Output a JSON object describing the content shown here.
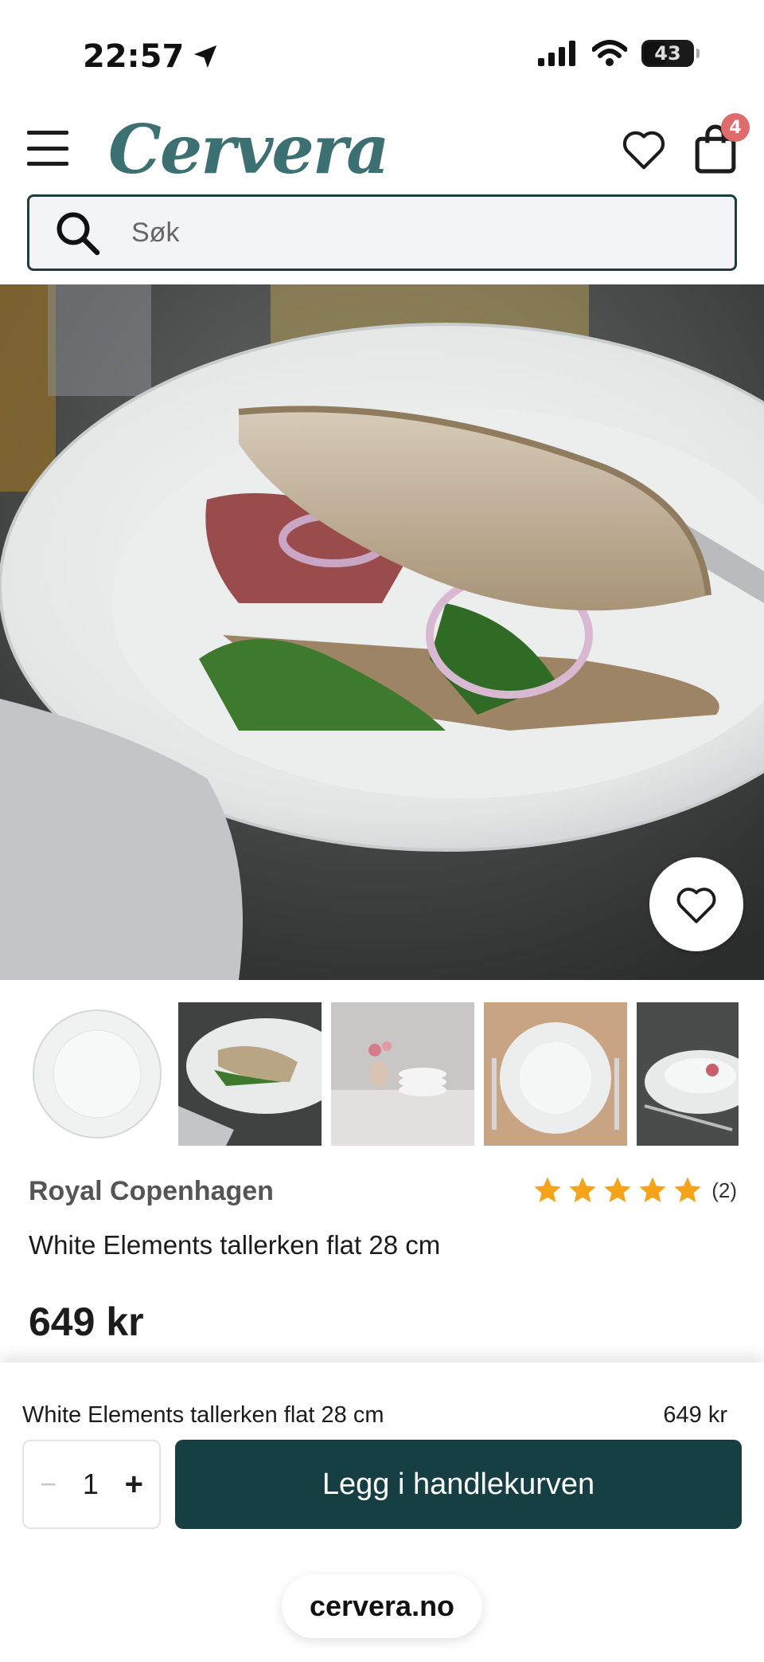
{
  "status_bar": {
    "time": "22:57",
    "battery": "43"
  },
  "header": {
    "logo": "Cervera",
    "cart_count": "4"
  },
  "search": {
    "placeholder": "Søk"
  },
  "product": {
    "brand": "Royal Copenhagen",
    "name": "White Elements tallerken flat 28 cm",
    "price": "649 kr",
    "rating_stars": 5,
    "rating_count": "(2)"
  },
  "sticky_bar": {
    "name": "White Elements tallerken flat 28 cm",
    "price": "649 kr",
    "quantity": "1",
    "minus": "−",
    "plus": "+",
    "add_to_cart": "Legg i handlekurven"
  },
  "browser": {
    "url": "cervera.no"
  },
  "colors": {
    "brand_teal": "#3c7174",
    "button_dark": "#153f42",
    "badge": "#e06b6b",
    "star": "#f5a418"
  },
  "icons": [
    "location-arrow-icon",
    "signal-icon",
    "wifi-icon",
    "battery-icon",
    "menu-icon",
    "heart-icon",
    "cart-icon",
    "search-icon",
    "star-icon"
  ]
}
